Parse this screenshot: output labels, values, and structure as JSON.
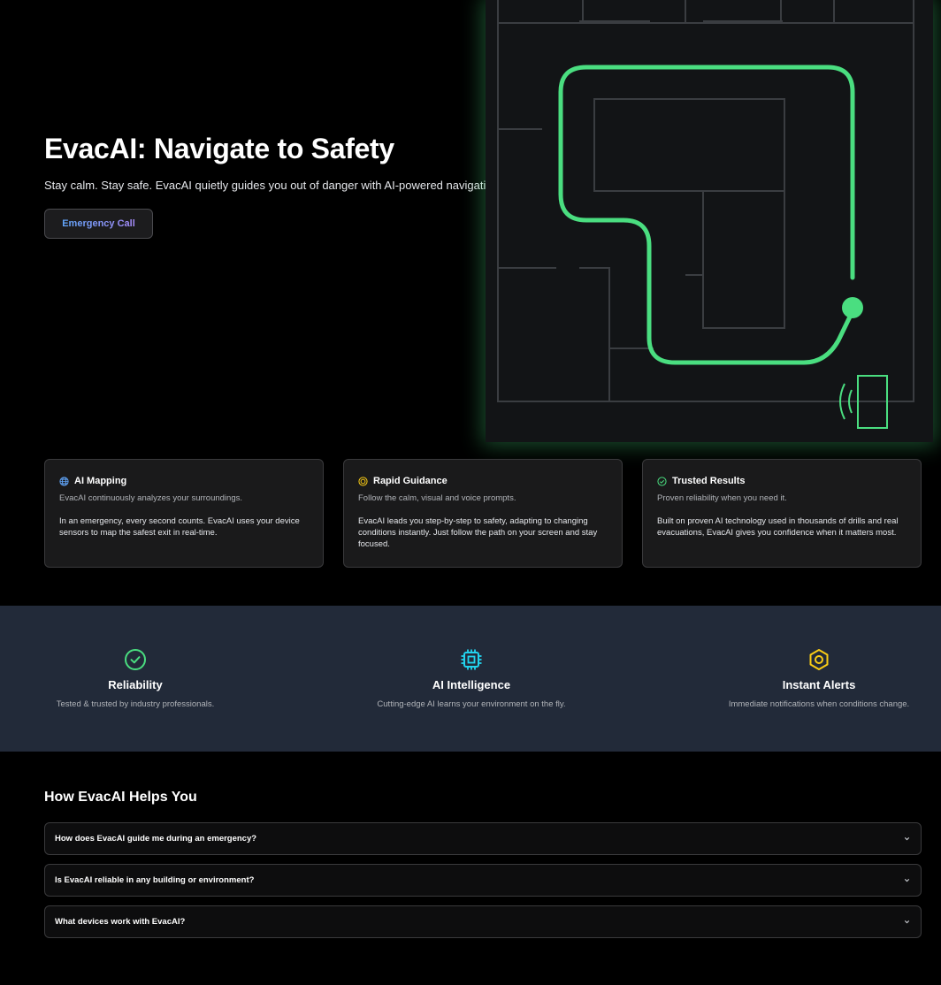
{
  "hero": {
    "title": "EvacAI: Navigate to Safety",
    "subtitle": "Stay calm. Stay safe. EvacAI quietly guides you out of danger with AI-powered navigation.",
    "cta_label": "Emergency Call"
  },
  "colors": {
    "path_green": "#4ade80",
    "band_bg": "#222a39",
    "gold": "#facc15",
    "cyan": "#22d3ee"
  },
  "features": [
    {
      "icon": "globe-icon",
      "title": "AI Mapping",
      "short": "EvacAI continuously analyzes your surroundings.",
      "long": "In an emergency, every second counts. EvacAI uses your device sensors to map the safest exit in real-time."
    },
    {
      "icon": "target-icon",
      "title": "Rapid Guidance",
      "short": "Follow the calm, visual and voice prompts.",
      "long": "EvacAI leads you step-by-step to safety, adapting to changing conditions instantly. Just follow the path on your screen and stay focused."
    },
    {
      "icon": "check-circle-icon",
      "title": "Trusted Results",
      "short": "Proven reliability when you need it.",
      "long": "Built on proven AI technology used in thousands of drills and real evacuations, EvacAI gives you confidence when it matters most."
    }
  ],
  "stats": [
    {
      "icon": "check-circle-icon",
      "title": "Reliability",
      "desc": "Tested & trusted by industry professionals."
    },
    {
      "icon": "cpu-chip-icon",
      "title": "AI Intelligence",
      "desc": "Cutting-edge AI learns your environment on the fly."
    },
    {
      "icon": "hexagon-nut-icon",
      "title": "Instant Alerts",
      "desc": "Immediate notifications when conditions change."
    }
  ],
  "faq": {
    "title": "How EvacAI Helps You",
    "items": [
      {
        "question": "How does EvacAI guide me during an emergency?"
      },
      {
        "question": "Is EvacAI reliable in any building or environment?"
      },
      {
        "question": "What devices work with EvacAI?"
      }
    ]
  }
}
